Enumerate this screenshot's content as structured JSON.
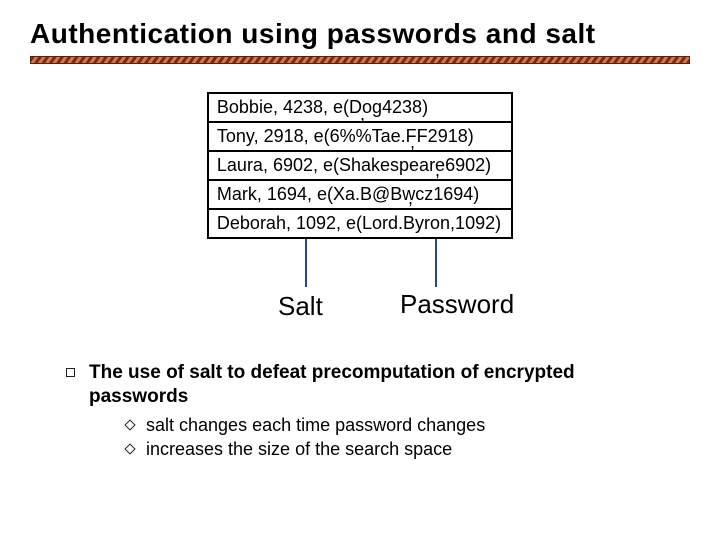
{
  "title": "Authentication using passwords and salt",
  "table": {
    "rows": [
      "Bobbie, 4238, e(Dog4238)",
      "Tony, 2918, e(6%%Tae.FF2918)",
      "Laura, 6902, e(Shakespeare6902)",
      "Mark, 1694, e(Xa.B@Bwcz1694)",
      "Deborah, 1092, e(Lord.Byron,1092)"
    ]
  },
  "commas": {
    "c1": ",",
    "c2": ",",
    "c3": ",",
    "c4": ","
  },
  "pointers": {
    "salt": "Salt",
    "password": "Password"
  },
  "bullets": {
    "main": "The use of salt to defeat precomputation of encrypted passwords",
    "sub1": "salt changes each time password changes",
    "sub2": "increases the size of the search space"
  }
}
